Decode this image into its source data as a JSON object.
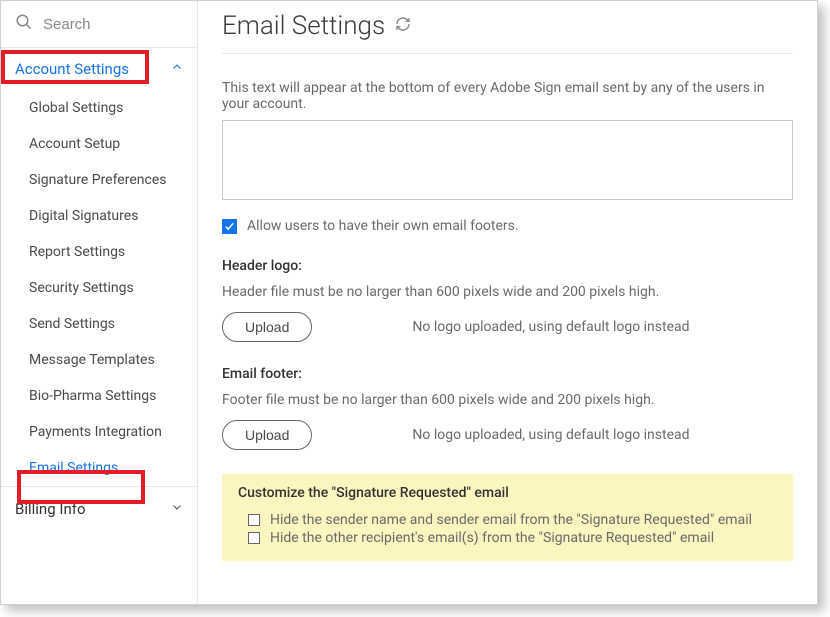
{
  "sidebar": {
    "search_placeholder": "Search",
    "account_settings_label": "Account Settings",
    "items": [
      {
        "label": "Global Settings"
      },
      {
        "label": "Account Setup"
      },
      {
        "label": "Signature Preferences"
      },
      {
        "label": "Digital Signatures"
      },
      {
        "label": "Report Settings"
      },
      {
        "label": "Security Settings"
      },
      {
        "label": "Send Settings"
      },
      {
        "label": "Message Templates"
      },
      {
        "label": "Bio-Pharma Settings"
      },
      {
        "label": "Payments Integration"
      },
      {
        "label": "Email Settings"
      }
    ],
    "billing_label": "Billing Info"
  },
  "main": {
    "title": "Email Settings",
    "footer_desc": "This text will appear at the bottom of every Adobe Sign email sent by any of the users in your account.",
    "allow_own_footers": "Allow users to have their own email footers.",
    "header_logo": {
      "label": "Header logo:",
      "hint": "Header file must be no larger than 600 pixels wide and 200 pixels high.",
      "upload_btn": "Upload",
      "status": "No logo uploaded, using default logo instead"
    },
    "email_footer": {
      "label": "Email footer:",
      "hint": "Footer file must be no larger than 600 pixels wide and 200 pixels high.",
      "upload_btn": "Upload",
      "status": "No logo uploaded, using default logo instead"
    },
    "customize": {
      "title": "Customize the \"Signature Requested\" email",
      "opt1": "Hide the sender name and sender email from the \"Signature Requested\" email",
      "opt2": "Hide the other recipient's email(s) from the \"Signature Requested\" email"
    }
  }
}
